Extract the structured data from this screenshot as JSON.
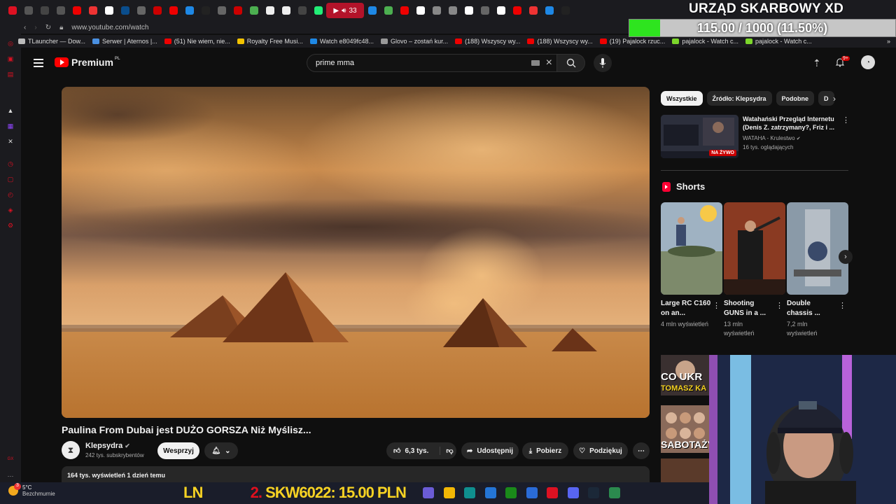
{
  "browser": {
    "tabs": [
      {
        "icon": "opera-icon",
        "color": "#d12"
      },
      {
        "icon": "game-icon",
        "color": "#555"
      },
      {
        "icon": "phone-icon",
        "color": "#444"
      },
      {
        "icon": "speaker-icon",
        "color": "#555"
      },
      {
        "icon": "youtube-icon",
        "color": "#e00"
      },
      {
        "icon": "csgo-icon",
        "color": "#e33"
      },
      {
        "icon": "tile-icon",
        "color": "#fff"
      },
      {
        "icon": "paypal-icon",
        "color": "#0a4d8c"
      },
      {
        "icon": "refresh-icon",
        "color": "#666"
      },
      {
        "icon": "bookmark-icon",
        "color": "#c00"
      },
      {
        "icon": "youtube-icon",
        "color": "#e00"
      },
      {
        "icon": "discord-icon",
        "color": "#1e88e5"
      },
      {
        "icon": "x-icon",
        "color": "#222"
      },
      {
        "icon": "refresh-icon",
        "color": "#666"
      },
      {
        "icon": "flag-icon",
        "color": "#c00"
      },
      {
        "icon": "globe-icon",
        "color": "#4caf50"
      },
      {
        "icon": "circle-icon",
        "color": "#eee"
      },
      {
        "icon": "circle-icon",
        "color": "#eee"
      },
      {
        "icon": "globe-icon",
        "color": "#444"
      },
      {
        "icon": "triangle-icon",
        "color": "#2e7"
      }
    ],
    "active_tab": {
      "count": "33"
    },
    "tabs_right": [
      {
        "icon": "discord-icon",
        "color": "#1e88e5"
      },
      {
        "icon": "chrome-icon",
        "color": "#4caf50"
      },
      {
        "icon": "youtube-icon",
        "color": "#e00"
      },
      {
        "icon": "tile-icon",
        "color": "#fff"
      },
      {
        "icon": "plus-icon",
        "color": "#888"
      },
      {
        "icon": "plus-icon",
        "color": "#888"
      },
      {
        "icon": "tile-icon",
        "color": "#fff"
      },
      {
        "icon": "search-icon",
        "color": "#666"
      },
      {
        "icon": "info-icon",
        "color": "#fff"
      },
      {
        "icon": "youtube-icon",
        "color": "#e00"
      },
      {
        "icon": "gmail-icon",
        "color": "#e33"
      },
      {
        "icon": "discord-icon",
        "color": "#1e88e5"
      },
      {
        "icon": "x-icon",
        "color": "#222"
      }
    ],
    "url": "www.youtube.com/watch",
    "bookmarks": [
      {
        "label": "TLauncher — Dow...",
        "color": "#bbb"
      },
      {
        "label": "Serwer | Aternos |...",
        "color": "#4a90e2"
      },
      {
        "label": "(51) Nie wiem, nie...",
        "color": "#e00"
      },
      {
        "label": "Royalty Free Musi...",
        "color": "#f3c300"
      },
      {
        "label": "Watch e8049fc48...",
        "color": "#1e88e5"
      },
      {
        "label": "Glovo – zostań kur...",
        "color": "#999"
      },
      {
        "label": "(188) Wszyscy wy...",
        "color": "#e00"
      },
      {
        "label": "(188) Wszyscy wy...",
        "color": "#e00"
      },
      {
        "label": "(19) Pajalock rzuc...",
        "color": "#e00"
      },
      {
        "label": "pajalock - Watch c...",
        "color": "#7cd62b"
      },
      {
        "label": "pajalock - Watch c...",
        "color": "#7cd62b"
      }
    ]
  },
  "overlay": {
    "title": "URZĄD SKARBOWY XD",
    "goal_text": "115.00 / 1000 (11.50%)",
    "goal_fraction": 0.115
  },
  "header": {
    "logo_text": "Premium",
    "logo_region": "PL",
    "search_value": "prime mma",
    "notifications_badge": "9+"
  },
  "video": {
    "title": "Paulina From Dubai jest DUŻO GORSZA Niż Myślisz...",
    "channel": "Klepsydra",
    "subscribers": "242 tys. subskrybentów",
    "support_label": "Wesprzyj",
    "likes": "6,3 tys.",
    "share_label": "Udostępnij",
    "download_label": "Pobierz",
    "thanks_label": "Podziękuj",
    "views_line": "164 tys. wyświetleń  1 dzień temu"
  },
  "chips": [
    "Wszystkie",
    "Źródło: Klepsydra",
    "Podobne",
    "D"
  ],
  "recommended": {
    "title": "Watahański Przegląd Internetu (Denis Z. zatrzymany?, Friz i ...",
    "channel": "WATAHA - Krulestwo",
    "views": "16 tys. oglądających",
    "live_label": "NA ŻYWO"
  },
  "shorts": {
    "heading": "Shorts",
    "items": [
      {
        "title": "Large RC C160 on an...",
        "views": "4 mln wyświetleń"
      },
      {
        "title": "Shooting GUNS in a ...",
        "views": "13 mln wyświetleń"
      },
      {
        "title": "Double chassis ...",
        "views": "7,2 mln wyświetleń"
      }
    ]
  },
  "lower_thumbs": [
    "CO UKR",
    "TOMASZ KA",
    "SABOTAŻY"
  ],
  "taskbar": {
    "weather_temp": "5°C",
    "weather_desc": "Bezchmurnie",
    "weather_badge": "3",
    "ticker_left": "LN",
    "ticker_num": "2.",
    "ticker_text": "SKW6022: 15.00 PLN",
    "icons": [
      {
        "icon": "copilot-icon",
        "color": "#6b5cd6"
      },
      {
        "icon": "folder-icon",
        "color": "#f2b705"
      },
      {
        "icon": "edge-icon",
        "color": "#0f8f8f"
      },
      {
        "icon": "store-icon",
        "color": "#2475d6"
      },
      {
        "icon": "xbox-icon",
        "color": "#1a8a1a"
      },
      {
        "icon": "paint-icon",
        "color": "#2a6bd8"
      },
      {
        "icon": "opera-icon",
        "color": "#d12"
      },
      {
        "icon": "discord-icon",
        "color": "#5865f2"
      },
      {
        "icon": "steam-icon",
        "color": "#1b2838"
      },
      {
        "icon": "app-icon",
        "color": "#2b8a4e"
      }
    ]
  }
}
